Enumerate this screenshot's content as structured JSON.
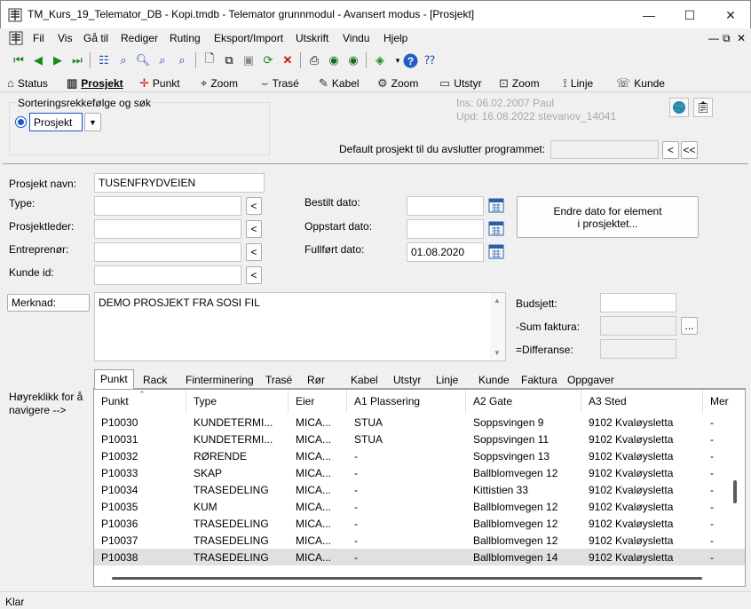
{
  "window": {
    "title": "TM_Kurs_19_Telemator_DB - Kopi.tmdb - Telemator grunnmodul - Avansert modus - [Prosjekt]",
    "minimize": "—",
    "maximize": "☐",
    "close": "✕"
  },
  "menu": [
    "Fil",
    "Vis",
    "Gå til",
    "Rediger",
    "Ruting",
    "Eksport/Import",
    "Utskrift",
    "Vindu",
    "Hjelp"
  ],
  "mdi_controls": [
    "—",
    "⧉",
    "✕"
  ],
  "module_tabs": [
    {
      "label": "Status",
      "icon": "house-icon"
    },
    {
      "label": "Prosjekt",
      "icon": "project-icon",
      "active": true
    },
    {
      "label": "Punkt",
      "icon": "point-icon"
    },
    {
      "label": "Zoom",
      "icon": "zoom-icon"
    },
    {
      "label": "Trasé",
      "icon": "route-icon"
    },
    {
      "label": "Kabel",
      "icon": "cable-icon"
    },
    {
      "label": "Zoom",
      "icon": "zoom-icon"
    },
    {
      "label": "Utstyr",
      "icon": "equipment-icon"
    },
    {
      "label": "Zoom",
      "icon": "zoom-icon"
    },
    {
      "label": "Linje",
      "icon": "line-icon"
    },
    {
      "label": "Kunde",
      "icon": "customer-icon"
    }
  ],
  "sort": {
    "group_label": "Sorteringsrekkefølge og søk",
    "selected": "Prosjekt"
  },
  "meta": {
    "ins": "Ins: 06.02.2007 Paul",
    "upd": "Upd: 16.08.2022 stevanov_14041"
  },
  "default_project": {
    "label": "Default prosjekt til du avslutter programmet:",
    "value": "",
    "btn_prev": "<",
    "btn_first": "<<"
  },
  "form": {
    "navn_label": "Prosjekt navn:",
    "navn_value": "TUSENFRYDVEIEN",
    "type_label": "Type:",
    "type_value": "",
    "leder_label": "Prosjektleder:",
    "leder_value": "",
    "entreprenor_label": "Entreprenør:",
    "entreprenor_value": "",
    "kunde_label": "Kunde id:",
    "kunde_value": "",
    "pick_btn": "<",
    "bestilt_label": "Bestilt dato:",
    "bestilt_value": "",
    "oppstart_label": "Oppstart dato:",
    "oppstart_value": "",
    "fullfort_label": "Fullført dato:",
    "fullfort_value": "01.08.2020",
    "endre_btn_line1": "Endre dato for element",
    "endre_btn_line2": "i prosjektet...",
    "merknad_label": "Merknad:",
    "merknad_value": "DEMO PROSJEKT FRA SOSI FIL",
    "budsjett_label": "Budsjett:",
    "budsjett_value": "",
    "sum_label": "-Sum faktura:",
    "sum_value": "",
    "sum_btn": "...",
    "diff_label": "=Differanse:",
    "diff_value": ""
  },
  "hint": "Høyreklikk for å navigere -->",
  "subtabs": [
    "Punkt",
    "Rack",
    "Finterminering",
    "Trasé",
    "Rør",
    "Kabel",
    "Utstyr",
    "Linje",
    "Kunde",
    "Faktura",
    "Oppgaver"
  ],
  "grid": {
    "columns": [
      "Punkt",
      "Type",
      "Eier",
      "A1 Plassering",
      "A2 Gate",
      "A3 Sted",
      "Mer"
    ],
    "rows": [
      [
        "P10030",
        "KUNDETERMI...",
        "MICA...",
        "STUA",
        "Soppsvingen 9",
        "9102 Kvaløysletta",
        "-"
      ],
      [
        "P10031",
        "KUNDETERMI...",
        "MICA...",
        "STUA",
        "Soppsvingen 11",
        "9102 Kvaløysletta",
        "-"
      ],
      [
        "P10032",
        "RØRENDE",
        "MICA...",
        "-",
        "Soppsvingen 13",
        "9102 Kvaløysletta",
        "-"
      ],
      [
        "P10033",
        "SKAP",
        "MICA...",
        "-",
        "Ballblomvegen 12",
        "9102 Kvaløysletta",
        "-"
      ],
      [
        "P10034",
        "TRASEDELING",
        "MICA...",
        "-",
        "Kittistien 33",
        "9102 Kvaløysletta",
        "-"
      ],
      [
        "P10035",
        "KUM",
        "MICA...",
        "-",
        "Ballblomvegen 12",
        "9102 Kvaløysletta",
        "-"
      ],
      [
        "P10036",
        "TRASEDELING",
        "MICA...",
        "-",
        "Ballblomvegen 12",
        "9102 Kvaløysletta",
        "-"
      ],
      [
        "P10037",
        "TRASEDELING",
        "MICA...",
        "-",
        "Ballblomvegen 12",
        "9102 Kvaløysletta",
        "-"
      ],
      [
        "P10038",
        "TRASEDELING",
        "MICA...",
        "-",
        "Ballblomvegen 14",
        "9102 Kvaløysletta",
        "-"
      ]
    ],
    "selected_row": 8
  },
  "status": "Klar"
}
